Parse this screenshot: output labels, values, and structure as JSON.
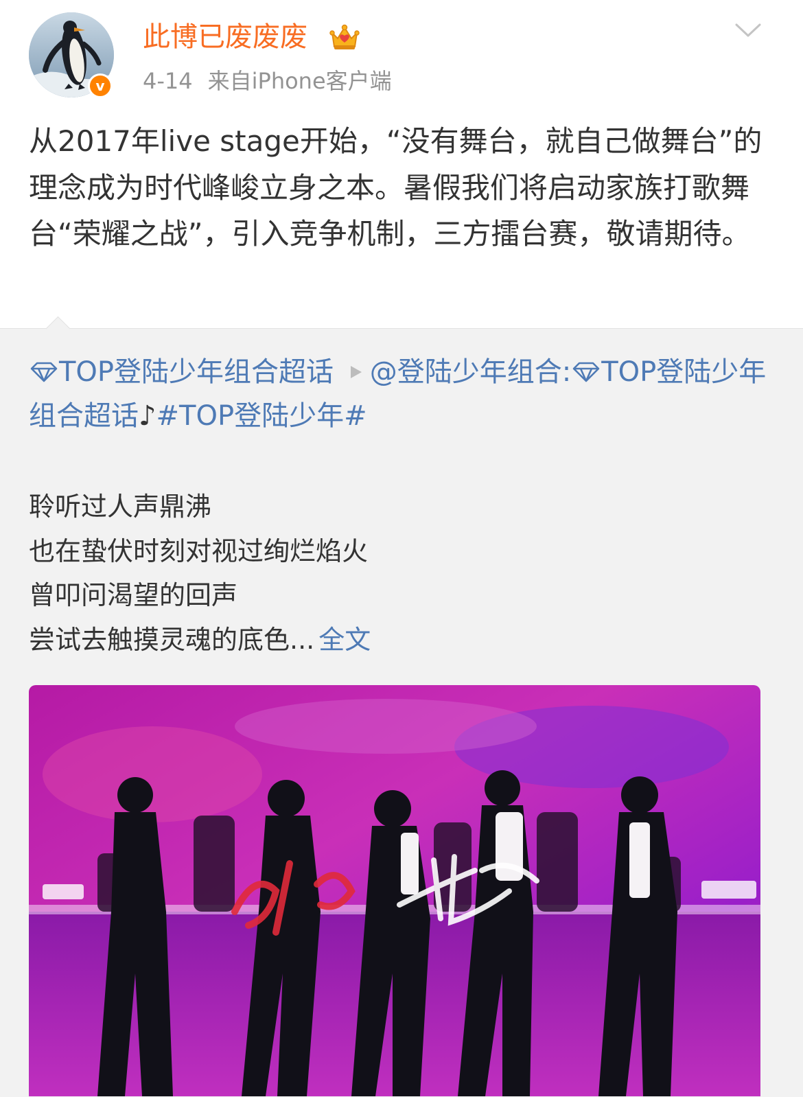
{
  "header": {
    "username": "此博已废废废",
    "date": "4-14",
    "source": "来自iPhone客户端",
    "verified_mark": "v"
  },
  "post": {
    "text": "从2017年live stage开始，“没有舞台，就自己做舞台”的理念成为时代峰峻立身之本。暑假我们将启动家族打歌舞台“荣耀之战”，引入竞争机制，三方擂台赛，敬请期待。"
  },
  "repost": {
    "supertopic_link": "TOP登陆少年组合超话",
    "mention": "@登陆少年组合:",
    "supertopic_link_2": "TOP登陆少年组合超话",
    "music_note": "♪",
    "hashtag": "#TOP登陆少年#",
    "poem": [
      "聆听过人声鼎沸",
      "也在蛰伏时刻对视过绚烂焰火",
      "曾叩问渴望的回声",
      "尝试去触摸灵魂的底色..."
    ],
    "read_more": "全文"
  },
  "colors": {
    "username": "#f86d23",
    "link": "#4e7ab5",
    "meta": "#939393",
    "repost_bg": "#f2f2f2",
    "verified": "#ff8200"
  },
  "icons": [
    "crown-icon",
    "chevron-down-icon",
    "diamond-icon",
    "play-icon",
    "verified-icon"
  ]
}
